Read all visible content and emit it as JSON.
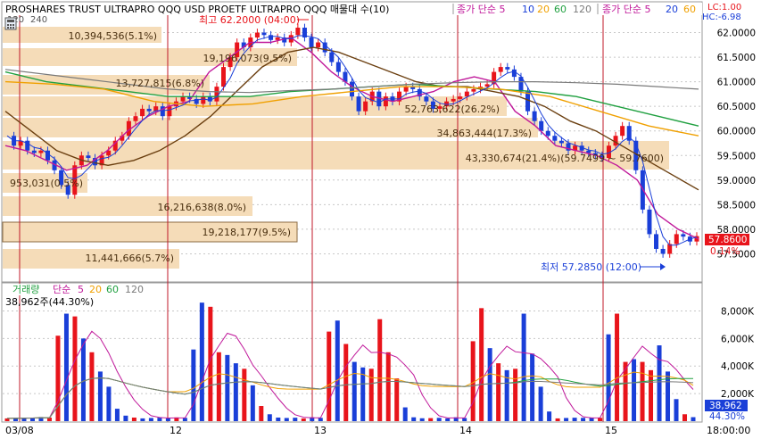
{
  "header": {
    "title": "PROSHARES TRUST ULTRAPRO QQQ USD  PROETF ULTRAPRO QQQ 매물대 수(10)",
    "ma_label": "종가 단순 5",
    "ma_periods": [
      "5",
      "10",
      "20",
      "60",
      "120"
    ],
    "ma_label_right": "종가 단순 5",
    "ma_periods_right": [
      "20",
      "60"
    ],
    "small_values": [
      "120",
      "240"
    ],
    "lc": "LC:1.00",
    "hc": "HC:-6.98"
  },
  "price_panel": {
    "high_label": "최고 62.2000 (04:00)",
    "low_label": "최저 57.2850 (12:00)",
    "current_price": "57.8600",
    "current_change": "0.14%",
    "y_ticks": [
      "62.0000",
      "61.5000",
      "61.0000",
      "60.5000",
      "60.0000",
      "59.5000",
      "59.0000",
      "58.5000",
      "58.0000",
      "57.5000"
    ],
    "volume_profile": [
      {
        "label": "10,394,536(5.1%)"
      },
      {
        "label": "19,196,073(9.5%)"
      },
      {
        "label": "13,727,815(6.8%)"
      },
      {
        "label": "52,763,622(26.2%)"
      },
      {
        "label": "34,863,444(17.3%)"
      },
      {
        "label": "43,330,674(21.4%)(59.7499 ~ 59.7600)"
      },
      {
        "label": "953,031(0.5%)"
      },
      {
        "label": "16,216,638(8.0%)"
      },
      {
        "label": "19,218,177(9.5%)"
      },
      {
        "label": "11,441,666(5.7%)"
      }
    ]
  },
  "volume_panel": {
    "legend_label": "거래량",
    "legend_ma": "단순",
    "legend_periods": [
      "5",
      "20",
      "60",
      "120"
    ],
    "current_label": "38,962주(44.30%)",
    "y_ticks": [
      "8,000K",
      "6,000K",
      "4,000K",
      "2,000K"
    ],
    "current_value": "38,962",
    "current_pct": "44.30%"
  },
  "x_axis": {
    "labels": [
      "03/08",
      "12",
      "13",
      "14",
      "15",
      "18:00:00"
    ]
  },
  "colors": {
    "up": "#e8141b",
    "down": "#1a3fd8",
    "profile": "#f5dcb8",
    "ma5": "#c0189a",
    "ma10": "#1a3fd8",
    "ma20": "#6b3f10",
    "ma60": "#20a040",
    "ma120": "#f0a000",
    "ma240": "#7a7a7a",
    "grid": "#c8c8c8"
  },
  "chart_data": [
    {
      "type": "candlestick",
      "title": "PROSHARES TRUST ULTRAPRO QQQ USD",
      "ylim": [
        57.0,
        62.3
      ],
      "sessions": [
        "03/08",
        "12",
        "13",
        "14",
        "15"
      ],
      "high": 62.2,
      "low": 57.285,
      "last": 57.86,
      "series": [
        {
          "name": "5",
          "values": [
            59.7,
            59.6,
            59.4,
            59.2,
            59.3,
            59.6,
            60.0,
            60.3,
            60.5,
            60.6,
            61.2,
            61.5,
            61.8,
            61.8,
            61.9,
            61.6,
            61.2,
            60.9,
            60.7,
            60.6,
            60.7,
            60.8,
            61.0,
            61.1,
            61.0,
            60.4,
            60.1,
            59.7,
            59.6,
            59.5,
            59.3,
            59.0,
            58.3,
            58.0,
            57.8
          ]
        },
        {
          "name": "20",
          "values": [
            60.4,
            60.0,
            59.6,
            59.4,
            59.3,
            59.4,
            59.6,
            59.9,
            60.3,
            60.8,
            61.3,
            61.6,
            61.7,
            61.6,
            61.4,
            61.2,
            61.0,
            60.9,
            60.9,
            60.8,
            60.7,
            60.5,
            60.2,
            60.0,
            59.7,
            59.4,
            59.1,
            58.8
          ]
        },
        {
          "name": "60",
          "values": [
            61.2,
            61.0,
            60.9,
            60.8,
            60.7,
            60.7,
            60.7,
            60.8,
            60.85,
            60.9,
            60.95,
            60.9,
            60.85,
            60.8,
            60.7,
            60.5,
            60.3,
            60.1
          ]
        },
        {
          "name": "120",
          "values": [
            61.0,
            60.95,
            60.85,
            60.6,
            60.5,
            60.55,
            60.7,
            60.8,
            60.9,
            60.9,
            60.85,
            60.7,
            60.4,
            60.1,
            59.9
          ]
        }
      ]
    },
    {
      "type": "bar",
      "title": "거래량",
      "ylim": [
        0,
        9000
      ],
      "series": [
        {
          "name": "volume",
          "values": [
            200,
            220,
            250,
            230,
            300,
            260,
            6200,
            7800,
            7600,
            6000,
            5000,
            3600,
            2500,
            900,
            400,
            260,
            200,
            230,
            250,
            200,
            270,
            240,
            5200,
            8600,
            8300,
            5000,
            4800,
            4200,
            3800,
            2600,
            1100,
            500,
            260,
            230,
            250,
            200,
            280,
            240,
            6500,
            7300,
            5600,
            4300,
            3900,
            3800,
            7400,
            5000,
            3100,
            1000,
            280,
            210,
            220,
            240,
            200,
            280,
            230,
            5800,
            8200,
            5300,
            4200,
            3700,
            3800,
            7800,
            4900,
            2500,
            700,
            200,
            230,
            250,
            240,
            260,
            240,
            6300,
            7800,
            4300,
            4500,
            4300,
            3700,
            5500,
            3600,
            1600,
            500,
            290
          ]
        }
      ]
    }
  ]
}
